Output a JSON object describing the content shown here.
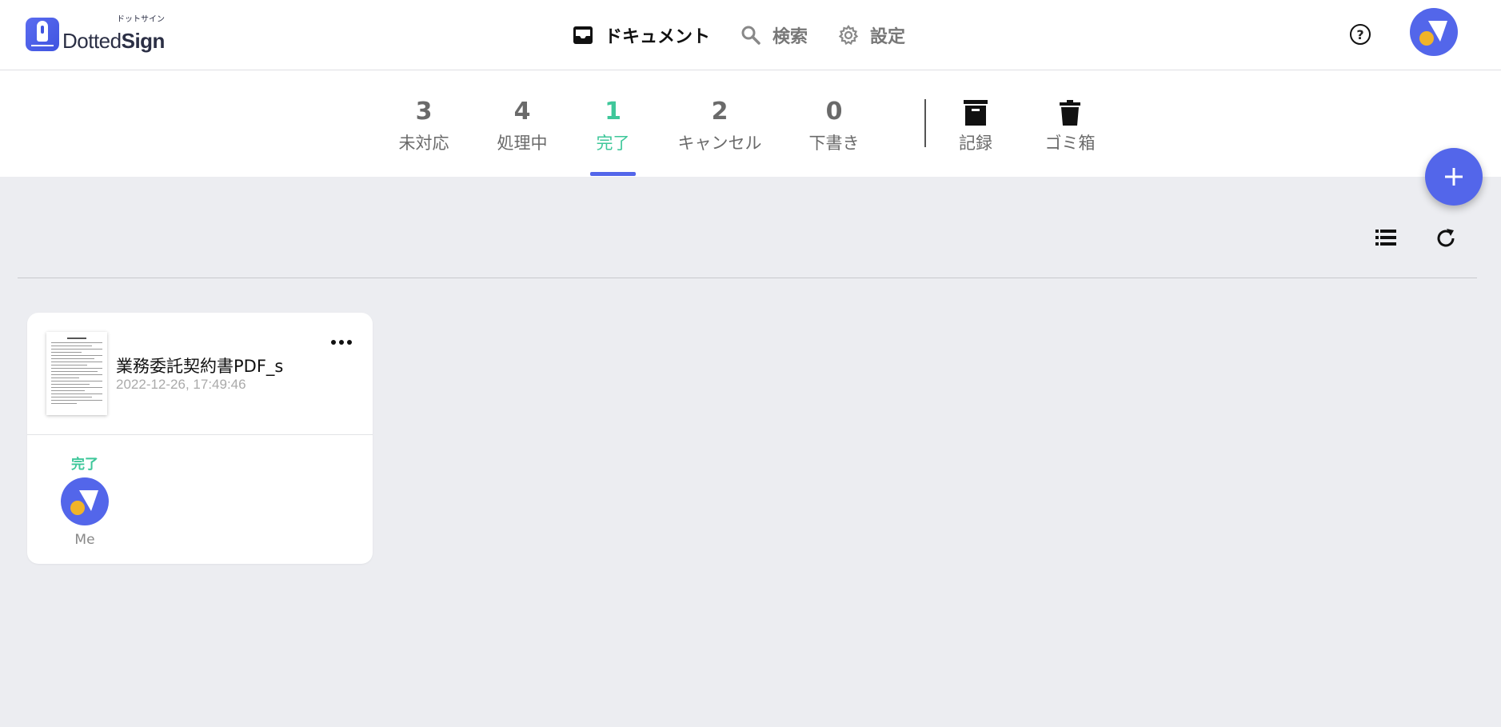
{
  "app": {
    "logo_kana": "ドットサイン",
    "logo_brand_light": "Dotted",
    "logo_brand_bold": "Sign"
  },
  "nav": {
    "items": [
      {
        "label": "ドキュメント",
        "icon": "inbox-icon",
        "active": true
      },
      {
        "label": "検索",
        "icon": "search-icon",
        "active": false
      },
      {
        "label": "設定",
        "icon": "gear-icon",
        "active": false
      }
    ],
    "help_icon": "help-circle-icon",
    "help_glyph": "?"
  },
  "tabs": [
    {
      "count": "3",
      "label": "未対応",
      "active": false
    },
    {
      "count": "4",
      "label": "処理中",
      "active": false
    },
    {
      "count": "1",
      "label": "完了",
      "active": true
    },
    {
      "count": "2",
      "label": "キャンセル",
      "active": false
    },
    {
      "count": "0",
      "label": "下書き",
      "active": false
    },
    {
      "icon": "archive-icon",
      "label": "記録"
    },
    {
      "icon": "trash-icon",
      "label": "ゴミ箱"
    }
  ],
  "documents": [
    {
      "title": "業務委託契約書PDF_s",
      "date": "2022-12-26, 17:49:46",
      "signers": [
        {
          "status": "完了",
          "name": "Me"
        }
      ]
    }
  ],
  "colors": {
    "accent": "#5366ea",
    "complete": "#3ec79a",
    "avatar_dot": "#f0b429",
    "background": "#ecedf1"
  }
}
